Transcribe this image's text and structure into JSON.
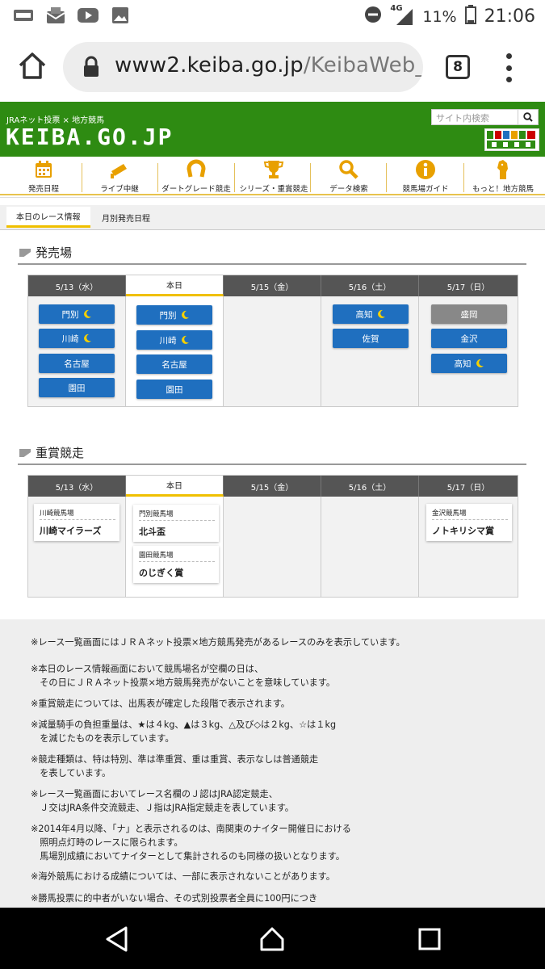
{
  "status_bar": {
    "network": "4G",
    "battery": "11%",
    "time": "21:06"
  },
  "browser": {
    "url_host": "www2.keiba.go.jp",
    "url_path": "/KeibaWeb_IPA",
    "tab_count": "8"
  },
  "site": {
    "subtitle": "JRAネット投票 × 地方競馬",
    "logo": "KEIBA.GO.JP",
    "search_placeholder": "サイト内検索"
  },
  "nav": [
    {
      "label": "発売日程",
      "icon": "calendar-icon"
    },
    {
      "label": "ライブ中継",
      "icon": "camera-icon"
    },
    {
      "label": "ダートグレード競走",
      "icon": "horseshoe-icon"
    },
    {
      "label": "シリーズ・重賞競走",
      "icon": "trophy-icon"
    },
    {
      "label": "データ検索",
      "icon": "search-icon"
    },
    {
      "label": "競馬場ガイド",
      "icon": "info-icon"
    },
    {
      "label": "もっと！地方競馬",
      "icon": "horse-icon"
    }
  ],
  "subtabs": {
    "active": "本日のレース情報",
    "other": "月別発売日程"
  },
  "sales": {
    "title": "発売場",
    "columns": [
      {
        "header": "5/13（水）",
        "venues": [
          {
            "name": "門別",
            "night": true
          },
          {
            "name": "川崎",
            "night": true
          },
          {
            "name": "名古屋",
            "night": false
          },
          {
            "name": "園田",
            "night": false
          }
        ]
      },
      {
        "header": "本日",
        "today": true,
        "venues": [
          {
            "name": "門別",
            "night": true
          },
          {
            "name": "川崎",
            "night": true
          },
          {
            "name": "名古屋",
            "night": false
          },
          {
            "name": "園田",
            "night": false
          }
        ]
      },
      {
        "header": "5/15（金）",
        "venues": []
      },
      {
        "header": "5/16（土）",
        "venues": [
          {
            "name": "高知",
            "night": true
          },
          {
            "name": "佐賀",
            "night": false
          }
        ]
      },
      {
        "header": "5/17（日）",
        "venues": [
          {
            "name": "盛岡",
            "night": false,
            "disabled": true
          },
          {
            "name": "金沢",
            "night": false
          },
          {
            "name": "高知",
            "night": true
          }
        ]
      }
    ]
  },
  "stakes": {
    "title": "重賞競走",
    "columns": [
      {
        "header": "5/13（水）",
        "races": [
          {
            "venue": "川崎競馬場",
            "name": "川崎マイラーズ"
          }
        ]
      },
      {
        "header": "本日",
        "today": true,
        "races": [
          {
            "venue": "門別競馬場",
            "name": "北斗盃"
          },
          {
            "venue": "園田競馬場",
            "name": "のじぎく賞"
          }
        ]
      },
      {
        "header": "5/15（金）",
        "races": []
      },
      {
        "header": "5/16（土）",
        "races": []
      },
      {
        "header": "5/17（日）",
        "races": [
          {
            "venue": "金沢競馬場",
            "name": "ノトキリシマ賞"
          }
        ]
      }
    ]
  },
  "notes": [
    [
      "※レース一覧画面にはＪＲＡネット投票×地方競馬発売があるレースのみを表示しています。"
    ],
    [
      "※本日のレース情報画面において競馬場名が空欄の日は、",
      "　その日にＪＲＡネット投票×地方競馬発売がないことを意味しています。"
    ],
    [
      "※重賞競走については、出馬表が確定した段階で表示されます。"
    ],
    [
      "※減量騎手の負担重量は、★は４kg、▲は３kg、△及び◇は２kg、☆は１kg",
      "　を減じたものを表示しています。"
    ],
    [
      "※競走種類は、特は特別、準は準重賞、重は重賞、表示なしは普通競走",
      "　を表しています。"
    ],
    [
      "※レース一覧画面においてレース名欄のＪ認はJRA認定競走、",
      "　Ｊ交はJRA条件交流競走、Ｊ指はJRA指定競走を表しています。"
    ],
    [
      "※2014年4月以降、「ナ」と表示されるのは、南関東のナイター開催日における",
      "　照明点灯時のレースに限られます。",
      "　馬場別成績においてナイターとして集計されるのも同様の扱いとなります。"
    ],
    [
      "※海外競馬における成績については、一部に表示されないことがあります。"
    ],
    [
      "※勝馬投票に的中者がいない場合、その式別投票者全員に100円につき"
    ]
  ]
}
